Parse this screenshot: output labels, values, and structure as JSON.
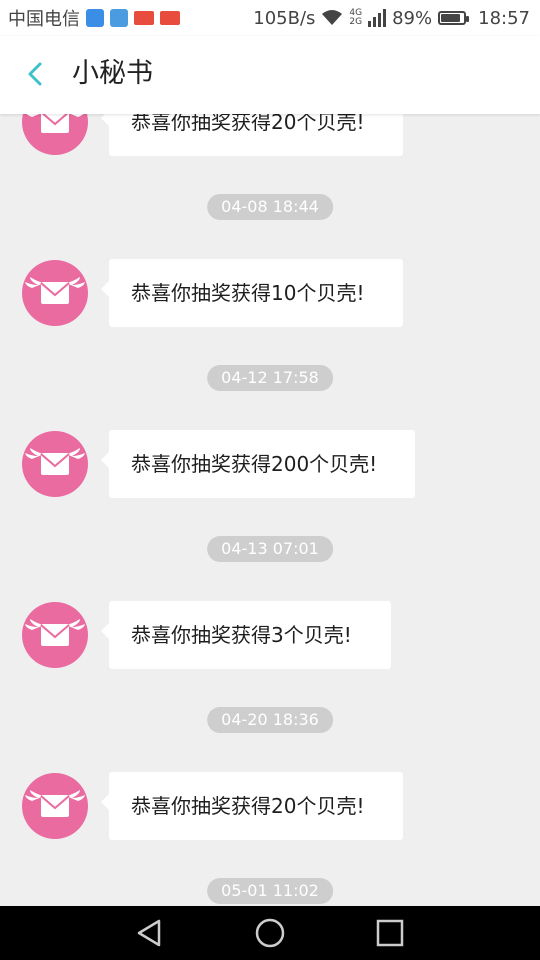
{
  "status_bar": {
    "carrier": "中国电信",
    "net_speed": "105B/s",
    "net_types": [
      "4G",
      "2G"
    ],
    "battery": "89%",
    "time": "18:57",
    "icons": [
      "app-icon",
      "gallery-icon",
      "news-icon",
      "news-icon",
      "wifi-icon",
      "signal-icon",
      "battery-icon"
    ]
  },
  "header": {
    "back_icon": "chevron-left-icon",
    "title": "小秘书",
    "accent_color": "#3cc2c8"
  },
  "conversation": {
    "avatar_icon": "winged-envelope-icon",
    "avatar_color": "#ea6ba0",
    "items": [
      {
        "type": "message",
        "text": "恭喜你抽奖获得20个贝壳!"
      },
      {
        "type": "timestamp",
        "text": "04-08 18:44"
      },
      {
        "type": "message",
        "text": "恭喜你抽奖获得10个贝壳!"
      },
      {
        "type": "timestamp",
        "text": "04-12 17:58"
      },
      {
        "type": "message",
        "text": "恭喜你抽奖获得200个贝壳!"
      },
      {
        "type": "timestamp",
        "text": "04-13 07:01"
      },
      {
        "type": "message",
        "text": "恭喜你抽奖获得3个贝壳!"
      },
      {
        "type": "timestamp",
        "text": "04-20 18:36"
      },
      {
        "type": "message",
        "text": "恭喜你抽奖获得20个贝壳!"
      },
      {
        "type": "timestamp",
        "text": "05-01 11:02"
      }
    ]
  },
  "nav_bar": {
    "icons": [
      "back-triangle-icon",
      "home-circle-icon",
      "recents-square-icon"
    ]
  }
}
